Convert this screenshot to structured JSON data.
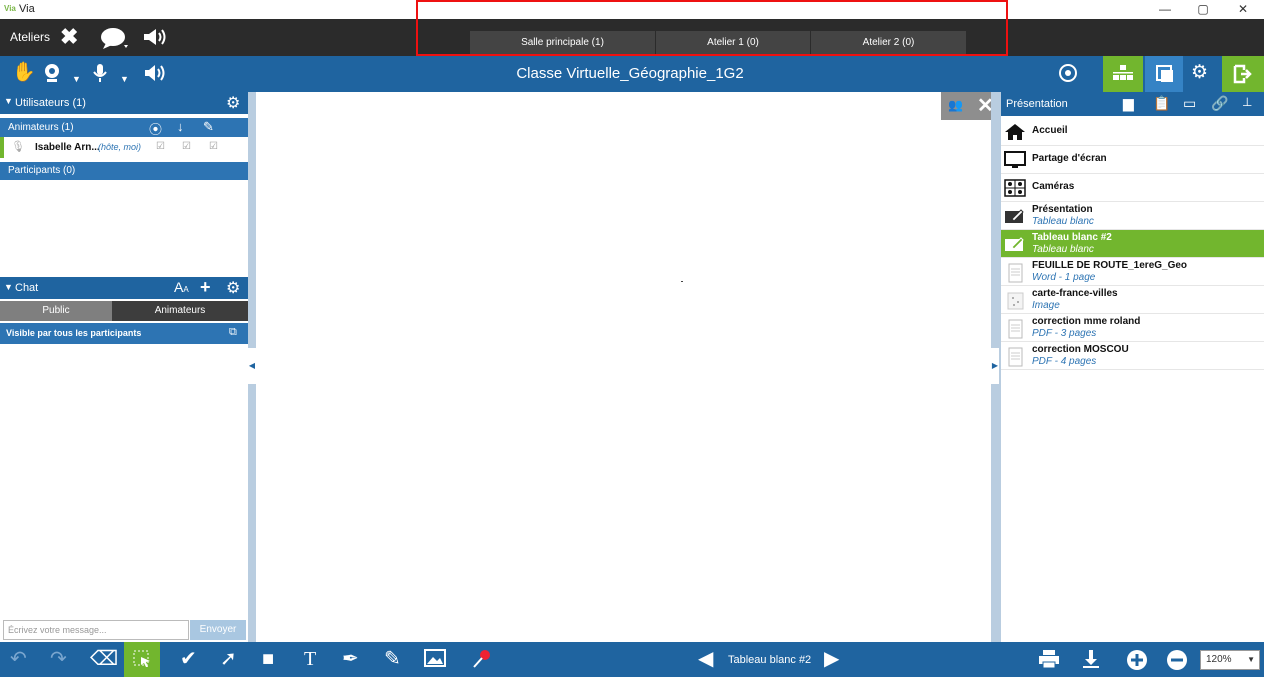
{
  "window": {
    "app_logo": "Via",
    "title": "Via",
    "min": "—",
    "max": "▢",
    "close": "✕"
  },
  "topbar": {
    "ateliers": "Ateliers",
    "rooms": [
      {
        "label": "Salle principale (1)",
        "active": true
      },
      {
        "label": "Atelier 1 (0)",
        "active": false
      },
      {
        "label": "Atelier 2 (0)",
        "active": false
      }
    ]
  },
  "mainbar": {
    "title": "Classe Virtuelle_Géographie_1G2"
  },
  "users": {
    "header": "Utilisateurs (1)",
    "animateurs_header": "Animateurs (1)",
    "user_name": "Isabelle Arn...",
    "user_role": "(hôte, moi)",
    "participants_header": "Participants (0)"
  },
  "chat": {
    "header": "Chat",
    "font_label": "A",
    "font_small": "A",
    "tabs": [
      "Public",
      "Animateurs"
    ],
    "visibility": "Visible par tous les participants",
    "placeholder": "Écrivez votre message...",
    "send": "Envoyer"
  },
  "presentation": {
    "header": "Présentation",
    "items": [
      {
        "name": "Accueil",
        "sub": "",
        "icon": "home-icon"
      },
      {
        "name": "Partage d'écran",
        "sub": "",
        "icon": "monitor-icon"
      },
      {
        "name": "Caméras",
        "sub": "",
        "icon": "camera-grid-icon"
      },
      {
        "name": "Présentation",
        "sub": "Tableau blanc",
        "icon": "whiteboard-icon"
      },
      {
        "name": "Tableau blanc #2",
        "sub": "Tableau blanc",
        "icon": "whiteboard-icon",
        "selected": true
      },
      {
        "name": "FEUILLE DE ROUTE_1ereG_Geo",
        "sub": "Word - 1 page",
        "icon": "document-icon"
      },
      {
        "name": "carte-france-villes",
        "sub": "Image",
        "icon": "image-icon"
      },
      {
        "name": "correction mme roland",
        "sub": "PDF - 3 pages",
        "icon": "pdf-icon"
      },
      {
        "name": "correction MOSCOU",
        "sub": "PDF - 4 pages",
        "icon": "pdf-icon"
      }
    ]
  },
  "bottombar": {
    "page_label": "Tableau blanc #2",
    "zoom": "120%"
  },
  "colors": {
    "accent": "#1f64a0",
    "selected": "#72b62e",
    "dark": "#2b2b2b",
    "highlight_border": "#e11111"
  }
}
